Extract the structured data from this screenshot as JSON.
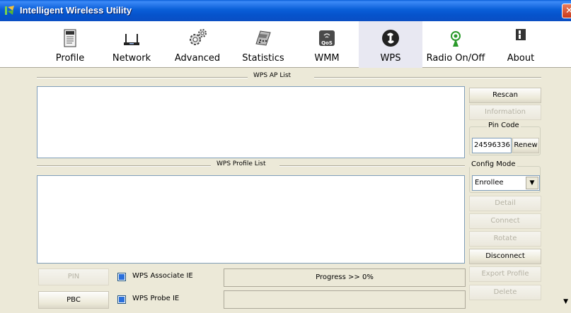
{
  "window": {
    "title": "Intelligent Wireless Utility",
    "close_glyph": "✕"
  },
  "toolbar": {
    "items": [
      {
        "label": "Profile",
        "icon": "profile-icon"
      },
      {
        "label": "Network",
        "icon": "network-icon"
      },
      {
        "label": "Advanced",
        "icon": "advanced-icon"
      },
      {
        "label": "Statistics",
        "icon": "statistics-icon"
      },
      {
        "label": "WMM",
        "icon": "wmm-qos-icon"
      },
      {
        "label": "WPS",
        "icon": "wps-icon"
      },
      {
        "label": "Radio On/Off",
        "icon": "radio-icon"
      },
      {
        "label": "About",
        "icon": "about-icon"
      }
    ],
    "active": "WPS",
    "wmm_badge": "QoS"
  },
  "wps": {
    "ap_list_title": "WPS AP List",
    "profile_list_title": "WPS Profile List",
    "buttons": {
      "rescan": "Rescan",
      "information": "Information",
      "renew": "Renew",
      "detail": "Detail",
      "connect": "Connect",
      "rotate": "Rotate",
      "disconnect": "Disconnect",
      "export_profile": "Export Profile",
      "delete": "Delete",
      "pin": "PIN",
      "pbc": "PBC"
    },
    "pin_code": {
      "label": "Pin Code",
      "value": "24596336"
    },
    "config_mode": {
      "label": "Config Mode",
      "value": "Enrollee"
    },
    "checkboxes": {
      "associate_ie": "WPS Associate IE",
      "probe_ie": "WPS Probe IE"
    },
    "progress_text": "Progress >> 0%"
  },
  "colors": {
    "title_blue": "#0a5fd8",
    "face": "#ece9d8",
    "list_border": "#7f9db9"
  }
}
